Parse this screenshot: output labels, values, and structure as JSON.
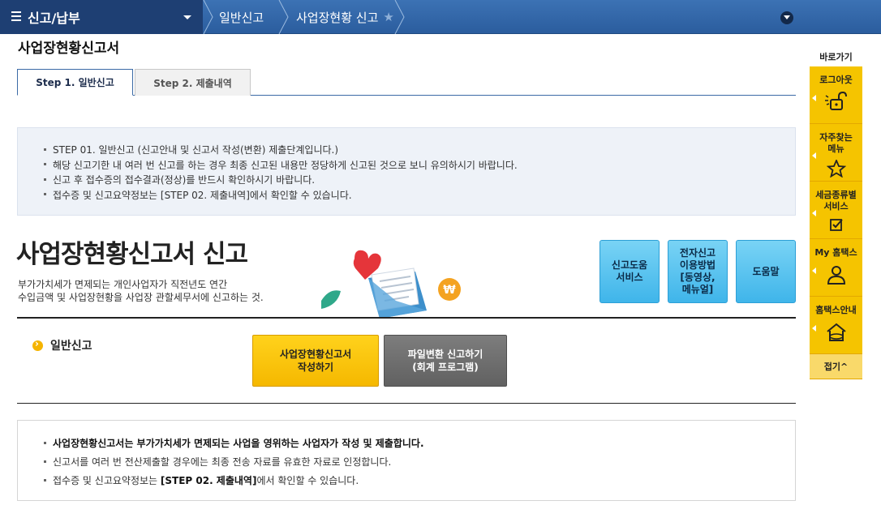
{
  "topbar": {
    "menu_label": "신고/납부",
    "breadcrumb_1": "일반신고",
    "breadcrumb_2": "사업장현황 신고"
  },
  "page_title": "사업장현황신고서",
  "tabs": [
    {
      "label": "Step 1. 일반신고"
    },
    {
      "label": "Step 2. 제출내역"
    }
  ],
  "info_box": [
    "STEP 01. 일반신고 (신고안내 및 신고서 작성(변환) 제출단계입니다.)",
    "해당 신고기한 내 여러 번 신고를 하는 경우 최종 신고된 내용만 정당하게 신고된 것으로 보니 유의하시기 바랍니다.",
    "신고 후 접수증의 접수결과(정상)를 반드시 확인하시기 바랍니다.",
    "접수증 및 신고요약정보는 [STEP 02. 제출내역]에서 확인할 수 있습니다."
  ],
  "main": {
    "heading": "사업장현황신고서 신고",
    "desc_line1": "부가가치세가 면제되는 개인사업자가 직전년도 연간",
    "desc_line2": "수입금액 및 사업장현황을 사업장 관할세무서에 신고하는 것."
  },
  "help_buttons": [
    {
      "line1": "신고도움",
      "line2": "서비스"
    },
    {
      "line1": "전자신고",
      "line2": "이용방법",
      "line3": "[동영상,",
      "line4": "메뉴얼]"
    },
    {
      "line1": "도움말"
    }
  ],
  "section": {
    "label": "일반신고",
    "btn_write_line1": "사업장현황신고서",
    "btn_write_line2": "작성하기",
    "btn_file_line1": "파일변환 신고하기",
    "btn_file_line2": "(회계 프로그램)"
  },
  "notice": {
    "line1": "사업장현황신고서는 부가가치세가 면제되는 사업을 영위하는 사업자가 작성 및 제출합니다.",
    "line2": "신고서를 여러 번 전산제출할 경우에는 최종 전송 자료를 유효한 자료로 인정합니다.",
    "line3_prefix": "접수증 및 신고요약정보는 ",
    "line3_bold": "[STEP 02. 제출내역]",
    "line3_suffix": "에서 확인할 수 있습니다."
  },
  "quick_menu": {
    "title": "바로가기",
    "items": [
      {
        "label": "로그아웃",
        "icon": "unlock-icon"
      },
      {
        "label1": "자주찾는",
        "label2": "메뉴",
        "icon": "star-icon"
      },
      {
        "label1": "세금종류별",
        "label2": "서비스",
        "icon": "checkbox-icon"
      },
      {
        "label": "My 홈택스",
        "icon": "user-icon"
      },
      {
        "label": "홈택스안내",
        "icon": "house-icon"
      }
    ],
    "close_label": "접기^"
  },
  "colors": {
    "topbar": "#2b5d9e",
    "menu_dark": "#1e3f73",
    "accent_yellow": "#f5c400",
    "help_blue": "#3fb5ea"
  }
}
